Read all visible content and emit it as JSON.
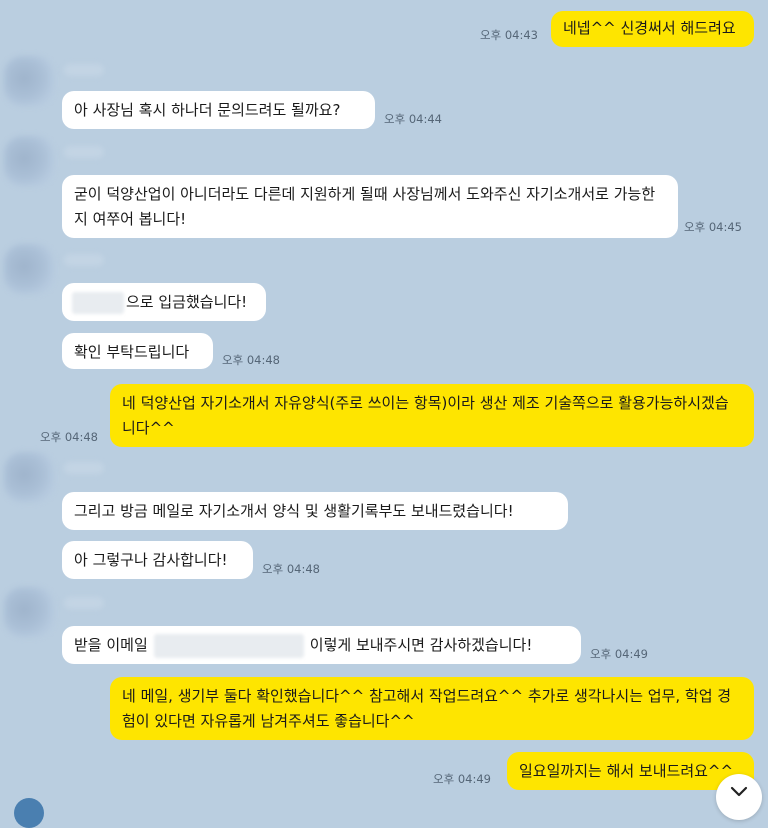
{
  "messages": [
    {
      "text": "네넵^^ 신경써서 해드려요",
      "time": "오후 04:43"
    },
    {
      "text": "아 사장님 혹시 하나더 문의드려도 될까요?",
      "time": "오후 04:44"
    },
    {
      "text": "굳이 덕양산업이 아니더라도 다른데 지원하게 될때 사장님께서 도와주신 자기소개서로 가능한지 여쭈어 봅니다!",
      "time": "오후 04:45"
    },
    {
      "text": "으로 입금했습니다!"
    },
    {
      "text": "확인 부탁드립니다",
      "time": "오후 04:48"
    },
    {
      "text": "네 덕양산업 자기소개서 자유양식(주로 쓰이는 항목)이라 생산 제조 기술쪽으로 활용가능하시겠습니다^^",
      "time": "오후 04:48"
    },
    {
      "text": "그리고 방금 메일로 자기소개서 양식 및 생활기록부도 보내드렸습니다!"
    },
    {
      "text": "아 그렇구나 감사합니다!",
      "time": "오후 04:48"
    },
    {
      "text_before": "받을 이메일",
      "text_after": "이렇게 보내주시면 감사하겠습니다!",
      "time": "오후 04:49"
    },
    {
      "text": "네 메일, 생기부 둘다 확인했습니다^^ 참고해서 작업드려요^^ 추가로 생각나시는 업무, 학업 경험이 있다면 자유롭게 남겨주셔도 좋습니다^^"
    },
    {
      "text": "일요일까지는 해서 보내드려요^^",
      "time": "오후 04:49"
    }
  ],
  "icons": {
    "scroll_down": "chevron-down-icon"
  },
  "colors": {
    "background": "#bacee0",
    "incoming_bubble": "#ffffff",
    "outgoing_bubble": "#fee500"
  }
}
